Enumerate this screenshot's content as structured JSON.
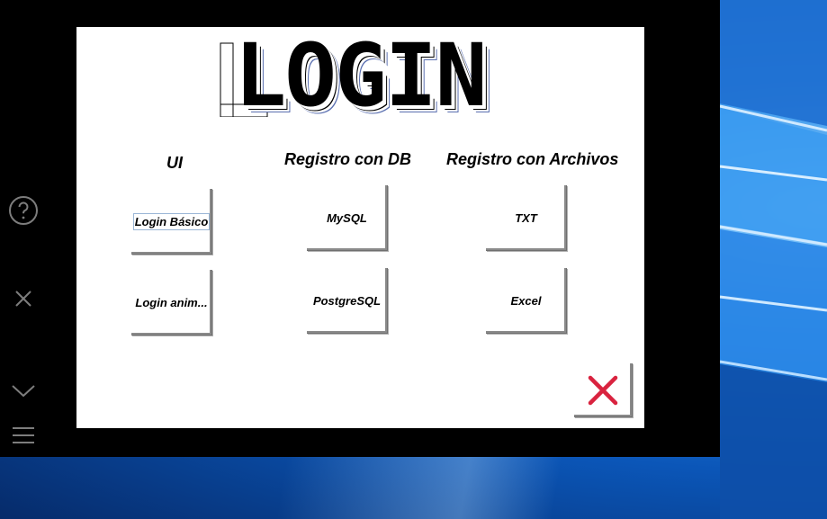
{
  "title": "LOGIN",
  "sidebar": {
    "icons": [
      "help-icon",
      "close-icon",
      "chevron-down-icon",
      "menu-icon"
    ]
  },
  "columns": {
    "ui": "UI",
    "db": "Registro con DB",
    "files": "Registro con Archivos"
  },
  "buttons": {
    "login_basic": "Login Básico",
    "login_animated": "Login anim...",
    "mysql": "MySQL",
    "postgresql": "PostgreSQL",
    "txt": "TXT",
    "excel": "Excel"
  },
  "colors": {
    "close_accent": "#d9233f",
    "frame": "#000000",
    "panel": "#ffffff"
  }
}
